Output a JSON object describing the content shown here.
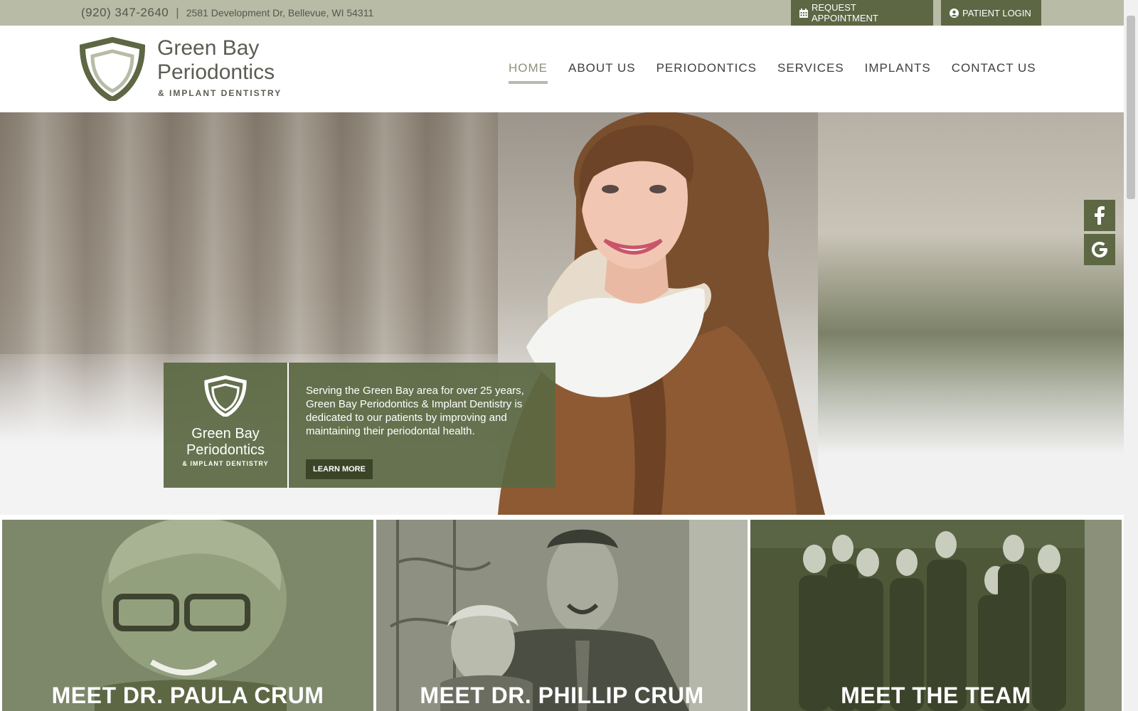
{
  "topbar": {
    "phone": "(920) 347-2640",
    "separator": "|",
    "address": "2581 Development Dr, Bellevue, WI 54311",
    "request_appointment": "REQUEST APPOINTMENT",
    "patient_login": "PATIENT LOGIN"
  },
  "logo": {
    "line1": "Green Bay",
    "line2": "Periodontics",
    "line3": "& IMPLANT DENTISTRY"
  },
  "nav": {
    "items": [
      {
        "label": "HOME",
        "active": true
      },
      {
        "label": "ABOUT US"
      },
      {
        "label": "PERIODONTICS"
      },
      {
        "label": "SERVICES"
      },
      {
        "label": "IMPLANTS"
      },
      {
        "label": "CONTACT US"
      }
    ]
  },
  "hero": {
    "text": "Serving the Green Bay area for over 25 years, Green Bay Periodontics & Implant Dentistry is dedicated to our patients by improving and maintaining their periodontal health.",
    "learn_more": "LEARN MORE",
    "logo_line1": "Green Bay",
    "logo_line2": "Periodontics",
    "logo_line3": "& IMPLANT DENTISTRY"
  },
  "social": {
    "facebook_icon": "facebook-icon",
    "google_icon": "google-icon"
  },
  "cards": [
    {
      "title": "MEET DR. PAULA CRUM"
    },
    {
      "title": "MEET DR. PHILLIP CRUM"
    },
    {
      "title": "MEET THE TEAM"
    }
  ],
  "colors": {
    "topbar": "#b8bba6",
    "brand_green": "#5d6744",
    "nav_active": "#8e917c"
  }
}
